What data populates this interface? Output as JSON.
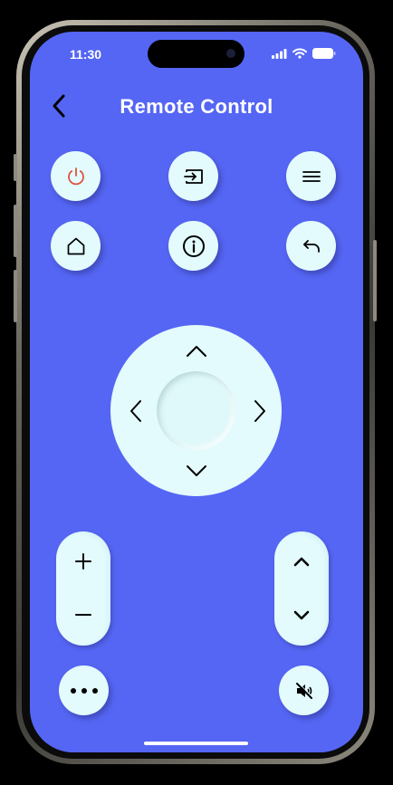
{
  "status_bar": {
    "time": "11:30"
  },
  "header": {
    "title": "Remote Control"
  },
  "buttons": {
    "power": "power-icon",
    "input": "input-source-icon",
    "menu": "menu-icon",
    "home": "home-icon",
    "info": "info-icon",
    "back": "return-icon",
    "more": "more-icon",
    "mute": "mute-icon"
  },
  "volume": {
    "up": "+",
    "down": "−"
  },
  "colors": {
    "screen_bg": "#5566f4",
    "button_bg": "#e3fbfc",
    "power_accent": "#e0523e"
  }
}
